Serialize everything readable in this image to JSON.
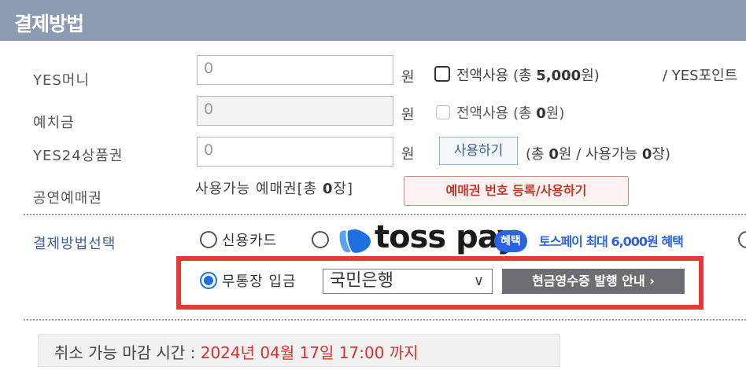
{
  "header": {
    "title": "결제방법"
  },
  "yes_money": {
    "label": "YES머니",
    "value": "0",
    "unit": "원",
    "use_all_prefix": "전액사용 (총 ",
    "use_all_amount": "5,000",
    "use_all_suffix": "원)",
    "point_text": "/ YES포인트"
  },
  "deposit": {
    "label": "예치금",
    "value": "0",
    "unit": "원",
    "use_all_prefix": "전액사용 (총 ",
    "use_all_amount": "0",
    "use_all_suffix": "원)"
  },
  "gift_card": {
    "label": "YES24상품권",
    "value": "0",
    "unit": "원",
    "use_button": "사용하기",
    "info_p1": "(총 ",
    "info_v1": "0",
    "info_p2": "원 / 사용가능 ",
    "info_v2": "0",
    "info_p3": "장)"
  },
  "ticket_voucher": {
    "label": "공연예매권",
    "available_prefix": "사용가능 예매권[총 ",
    "available_count": "0",
    "available_suffix": "장]",
    "register_button": "예매권 번호 등록/사용하기"
  },
  "payment_method": {
    "label": "결제방법선택",
    "credit_card": "신용카드",
    "toss_wordmark": "toss pay",
    "toss_badge": "혜택",
    "toss_promo": "토스페이 최대 6,000원 혜택",
    "bank_transfer": "무통장 입금",
    "bank_selected": "국민은행",
    "receipt_button": "현금영수증 발행 안내 ›"
  },
  "deadline": {
    "label": "취소 가능 마감 시간 : ",
    "value": "2024년 04월 17일 17:00 까지"
  },
  "colors": {
    "header_bg": "#8c9bb2",
    "accent_blue": "#1e6fe0",
    "toss_blue": "#2b62e3",
    "highlight_red": "#e53935",
    "deadline_red": "#d63031"
  }
}
